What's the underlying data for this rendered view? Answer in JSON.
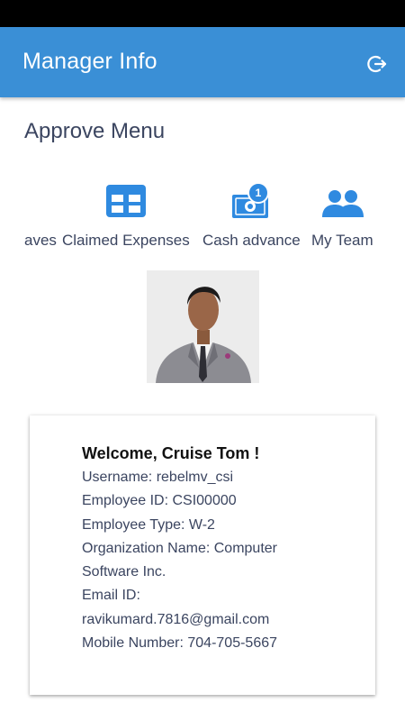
{
  "app_bar": {
    "title": "Manager Info",
    "logout_icon": "logout-icon"
  },
  "approve_menu": {
    "title": "Approve Menu",
    "items": [
      {
        "label": "Leaves",
        "icon": "calendar-icon",
        "visible_label": "aves"
      },
      {
        "label": "Claimed Expenses",
        "icon": "expenses-icon"
      },
      {
        "label": "Cash advance",
        "icon": "cash-icon",
        "badge": "1"
      },
      {
        "label": "My Team",
        "icon": "team-icon"
      }
    ]
  },
  "profile": {
    "photo": "profile-photo",
    "welcome": "Welcome, Cruise Tom !",
    "username": "Username: rebelmv_csi",
    "employee_id": "Employee ID: CSI00000",
    "employee_type": "Employee Type: W-2",
    "organization_line1": "Organization Name: Computer",
    "organization_line2": "Software Inc.",
    "email_label": "Email ID:",
    "email_value": "ravikumard.7816@gmail.com",
    "mobile": "Mobile Number: 704-705-5667"
  },
  "colors": {
    "app_bar": "#3a8fd6",
    "accent_icon": "#2f8ae0",
    "text": "#3b4560"
  }
}
